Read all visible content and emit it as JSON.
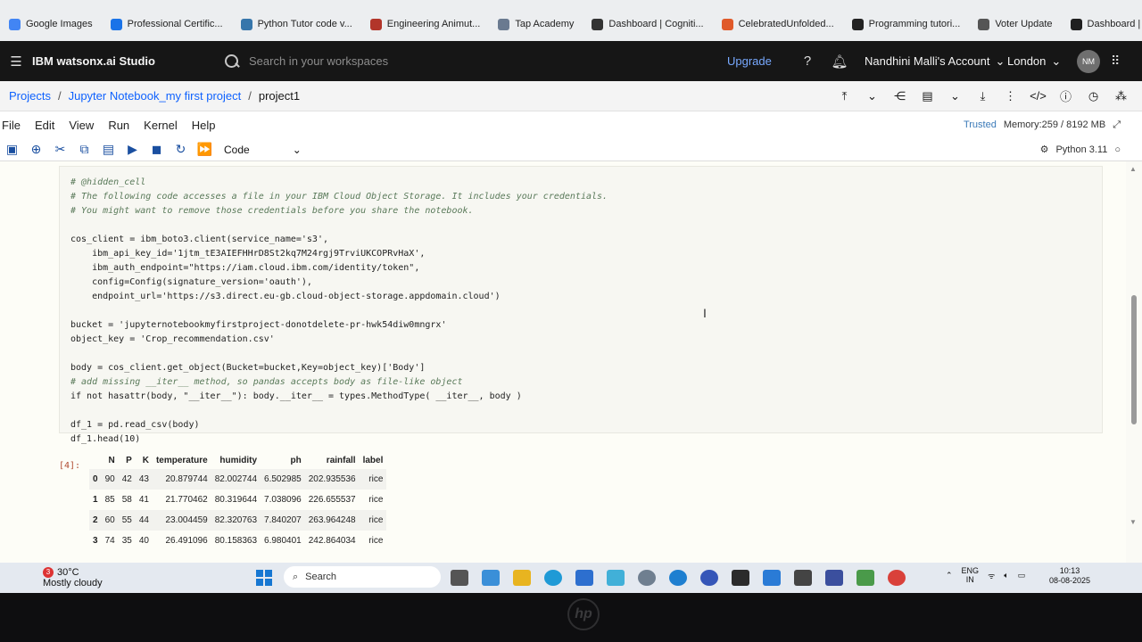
{
  "browser": {
    "bookmarks": [
      {
        "label": "Google Images",
        "color": "#4285f4"
      },
      {
        "label": "Professional Certific...",
        "color": "#1a73e8"
      },
      {
        "label": "Python Tutor code v...",
        "color": "#3776ab"
      },
      {
        "label": "Engineering Animut...",
        "color": "#b2352a"
      },
      {
        "label": "Tap Academy",
        "color": "#6a7a90"
      },
      {
        "label": "Dashboard | Cogniti...",
        "color": "#333333"
      },
      {
        "label": "CelebratedUnfolded...",
        "color": "#e05a2a"
      },
      {
        "label": "Programming tutori...",
        "color": "#222222"
      },
      {
        "label": "Voter Update",
        "color": "#555555"
      },
      {
        "label": "Dashboard | Hacker...",
        "color": "#1f1f1f"
      }
    ],
    "more": "»"
  },
  "header": {
    "brand": "IBM watsonx.ai Studio",
    "search_placeholder": "Search in your workspaces",
    "upgrade": "Upgrade",
    "account": "Nandhini Malli's Account",
    "region": "London",
    "avatar": "NM"
  },
  "breadcrumb": {
    "projects": "Projects",
    "notebook": "Jupyter Notebook_my first project",
    "current": "project1"
  },
  "jupyter": {
    "menu": [
      "File",
      "Edit",
      "View",
      "Run",
      "Kernel",
      "Help"
    ],
    "trusted": "Trusted",
    "memory": "Memory:259 / 8192 MB",
    "cell_type": "Code",
    "kernel": "Python 3.11"
  },
  "code_lines": [
    "# @hidden_cell",
    "# The following code accesses a file in your IBM Cloud Object Storage. It includes your credentials.",
    "# You might want to remove those credentials before you share the notebook.",
    "",
    "cos_client = ibm_boto3.client(service_name='s3',",
    "    ibm_api_key_id='1jtm_tE3AIEFHHrD8St2kq7M24rgj9TrviUKCOPRvHaX',",
    "    ibm_auth_endpoint=\"https://iam.cloud.ibm.com/identity/token\",",
    "    config=Config(signature_version='oauth'),",
    "    endpoint_url='https://s3.direct.eu-gb.cloud-object-storage.appdomain.cloud')",
    "",
    "bucket = 'jupyternotebookmyfirstproject-donotdelete-pr-hwk54diw0mngrx'",
    "object_key = 'Crop_recommendation.csv'",
    "",
    "body = cos_client.get_object(Bucket=bucket,Key=object_key)['Body']",
    "# add missing __iter__ method, so pandas accepts body as file-like object",
    "if not hasattr(body, \"__iter__\"): body.__iter__ = types.MethodType( __iter__, body )",
    "",
    "df_1 = pd.read_csv(body)",
    "df_1.head(10)"
  ],
  "output": {
    "prompt": "[4]:",
    "columns": [
      "",
      "N",
      "P",
      "K",
      "temperature",
      "humidity",
      "ph",
      "rainfall",
      "label"
    ],
    "rows": [
      [
        "0",
        "90",
        "42",
        "43",
        "20.879744",
        "82.002744",
        "6.502985",
        "202.935536",
        "rice"
      ],
      [
        "1",
        "85",
        "58",
        "41",
        "21.770462",
        "80.319644",
        "7.038096",
        "226.655537",
        "rice"
      ],
      [
        "2",
        "60",
        "55",
        "44",
        "23.004459",
        "82.320763",
        "7.840207",
        "263.964248",
        "rice"
      ],
      [
        "3",
        "74",
        "35",
        "40",
        "26.491096",
        "80.158363",
        "6.980401",
        "242.864034",
        "rice"
      ]
    ]
  },
  "taskbar": {
    "weather_temp": "30°C",
    "weather_desc": "Mostly cloudy",
    "badge": "3",
    "search": "Search",
    "lang1": "ENG",
    "lang2": "IN",
    "time": "10:13",
    "date": "08-08-2025"
  },
  "laptop_logo": "hp"
}
